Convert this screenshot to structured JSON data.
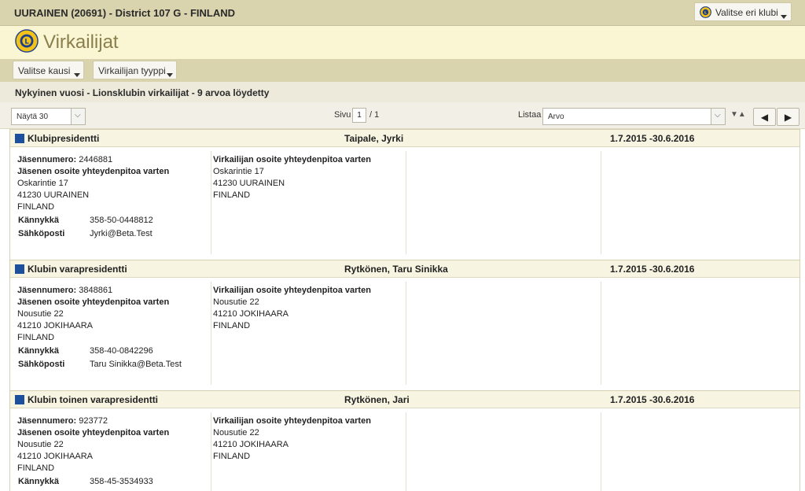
{
  "header": {
    "club_title": "UURAINEN (20691) - District 107 G - FINLAND",
    "choose_club_label": "Valitse eri klubi"
  },
  "page": {
    "title": "Virkailijat"
  },
  "menu": {
    "select_season": "Valitse kausi",
    "officer_type": "Virkailijan tyyppi"
  },
  "info": {
    "text": "Nykyinen vuosi - Lionsklubin virkailijat - 9 arvoa löydetty"
  },
  "pager": {
    "show_label": "Näytä 30",
    "page_label": "Sivu",
    "page_value": "1",
    "page_total": "/ 1",
    "list_label": "Listaa",
    "list_value": "Arvo",
    "prev": "◀",
    "next": "▶"
  },
  "labels": {
    "member_number": "Jäsennumero:",
    "member_address": "Jäsenen osoite yhteydenpitoa varten",
    "officer_address": "Virkailijan osoite yhteydenpitoa varten",
    "mobile": "Kännykkä",
    "email": "Sähköposti"
  },
  "officers": [
    {
      "role": "Klubipresidentti",
      "name": "Taipale, Jyrki",
      "period": "1.7.2015 -30.6.2016",
      "member_number": "2446881",
      "address": [
        "Oskarintie 17",
        "41230 UURAINEN",
        "FINLAND"
      ],
      "officer_address": [
        "Oskarintie 17",
        "41230 UURAINEN",
        "FINLAND"
      ],
      "mobile": "358-50-0448812",
      "email": "Jyrki@Beta.Test"
    },
    {
      "role": "Klubin varapresidentti",
      "name": "Rytkönen, Taru Sinikka",
      "period": "1.7.2015 -30.6.2016",
      "member_number": "3848861",
      "address": [
        "Nousutie 22",
        "41210 JOKIHAARA",
        "FINLAND"
      ],
      "officer_address": [
        "Nousutie 22",
        "41210 JOKIHAARA",
        "FINLAND"
      ],
      "mobile": "358-40-0842296",
      "email": "Taru Sinikka@Beta.Test"
    },
    {
      "role": "Klubin toinen varapresidentti",
      "name": "Rytkönen, Jari",
      "period": "1.7.2015 -30.6.2016",
      "member_number": "923772",
      "address": [
        "Nousutie 22",
        "41210 JOKIHAARA",
        "FINLAND"
      ],
      "officer_address": [
        "Nousutie 22",
        "41210 JOKIHAARA",
        "FINLAND"
      ],
      "mobile": "358-45-3534933",
      "email": ""
    }
  ]
}
